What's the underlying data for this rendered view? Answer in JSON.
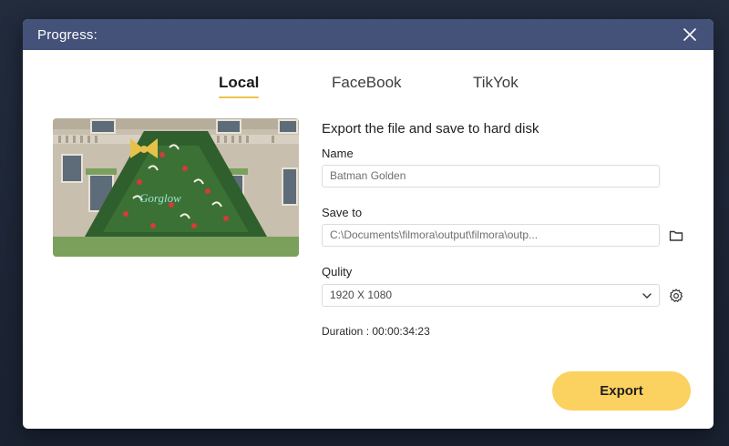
{
  "dialog": {
    "title": "Progress:"
  },
  "tabs": [
    {
      "label": "Local",
      "active": true
    },
    {
      "label": "FaceBook",
      "active": false
    },
    {
      "label": "TikYok",
      "active": false
    }
  ],
  "form": {
    "heading": "Export the file and save to hard disk",
    "name_label": "Name",
    "name_value": "Batman Golden",
    "save_to_label": "Save to",
    "save_to_value": "C:\\Documents\\filmora\\output\\filmora\\outp...",
    "quality_label": "Qulity",
    "quality_value": "1920 X 1080",
    "duration_text": "Duration : 00:00:34:23"
  },
  "export_label": "Export",
  "icons": {
    "close": "close-icon",
    "folder": "folder-icon",
    "settings": "gear-icon",
    "dropdown": "chevron-down-icon"
  },
  "colors": {
    "titlebar": "#44527a",
    "accent": "#fbd15f",
    "tab_underline": "#f2c14e"
  }
}
